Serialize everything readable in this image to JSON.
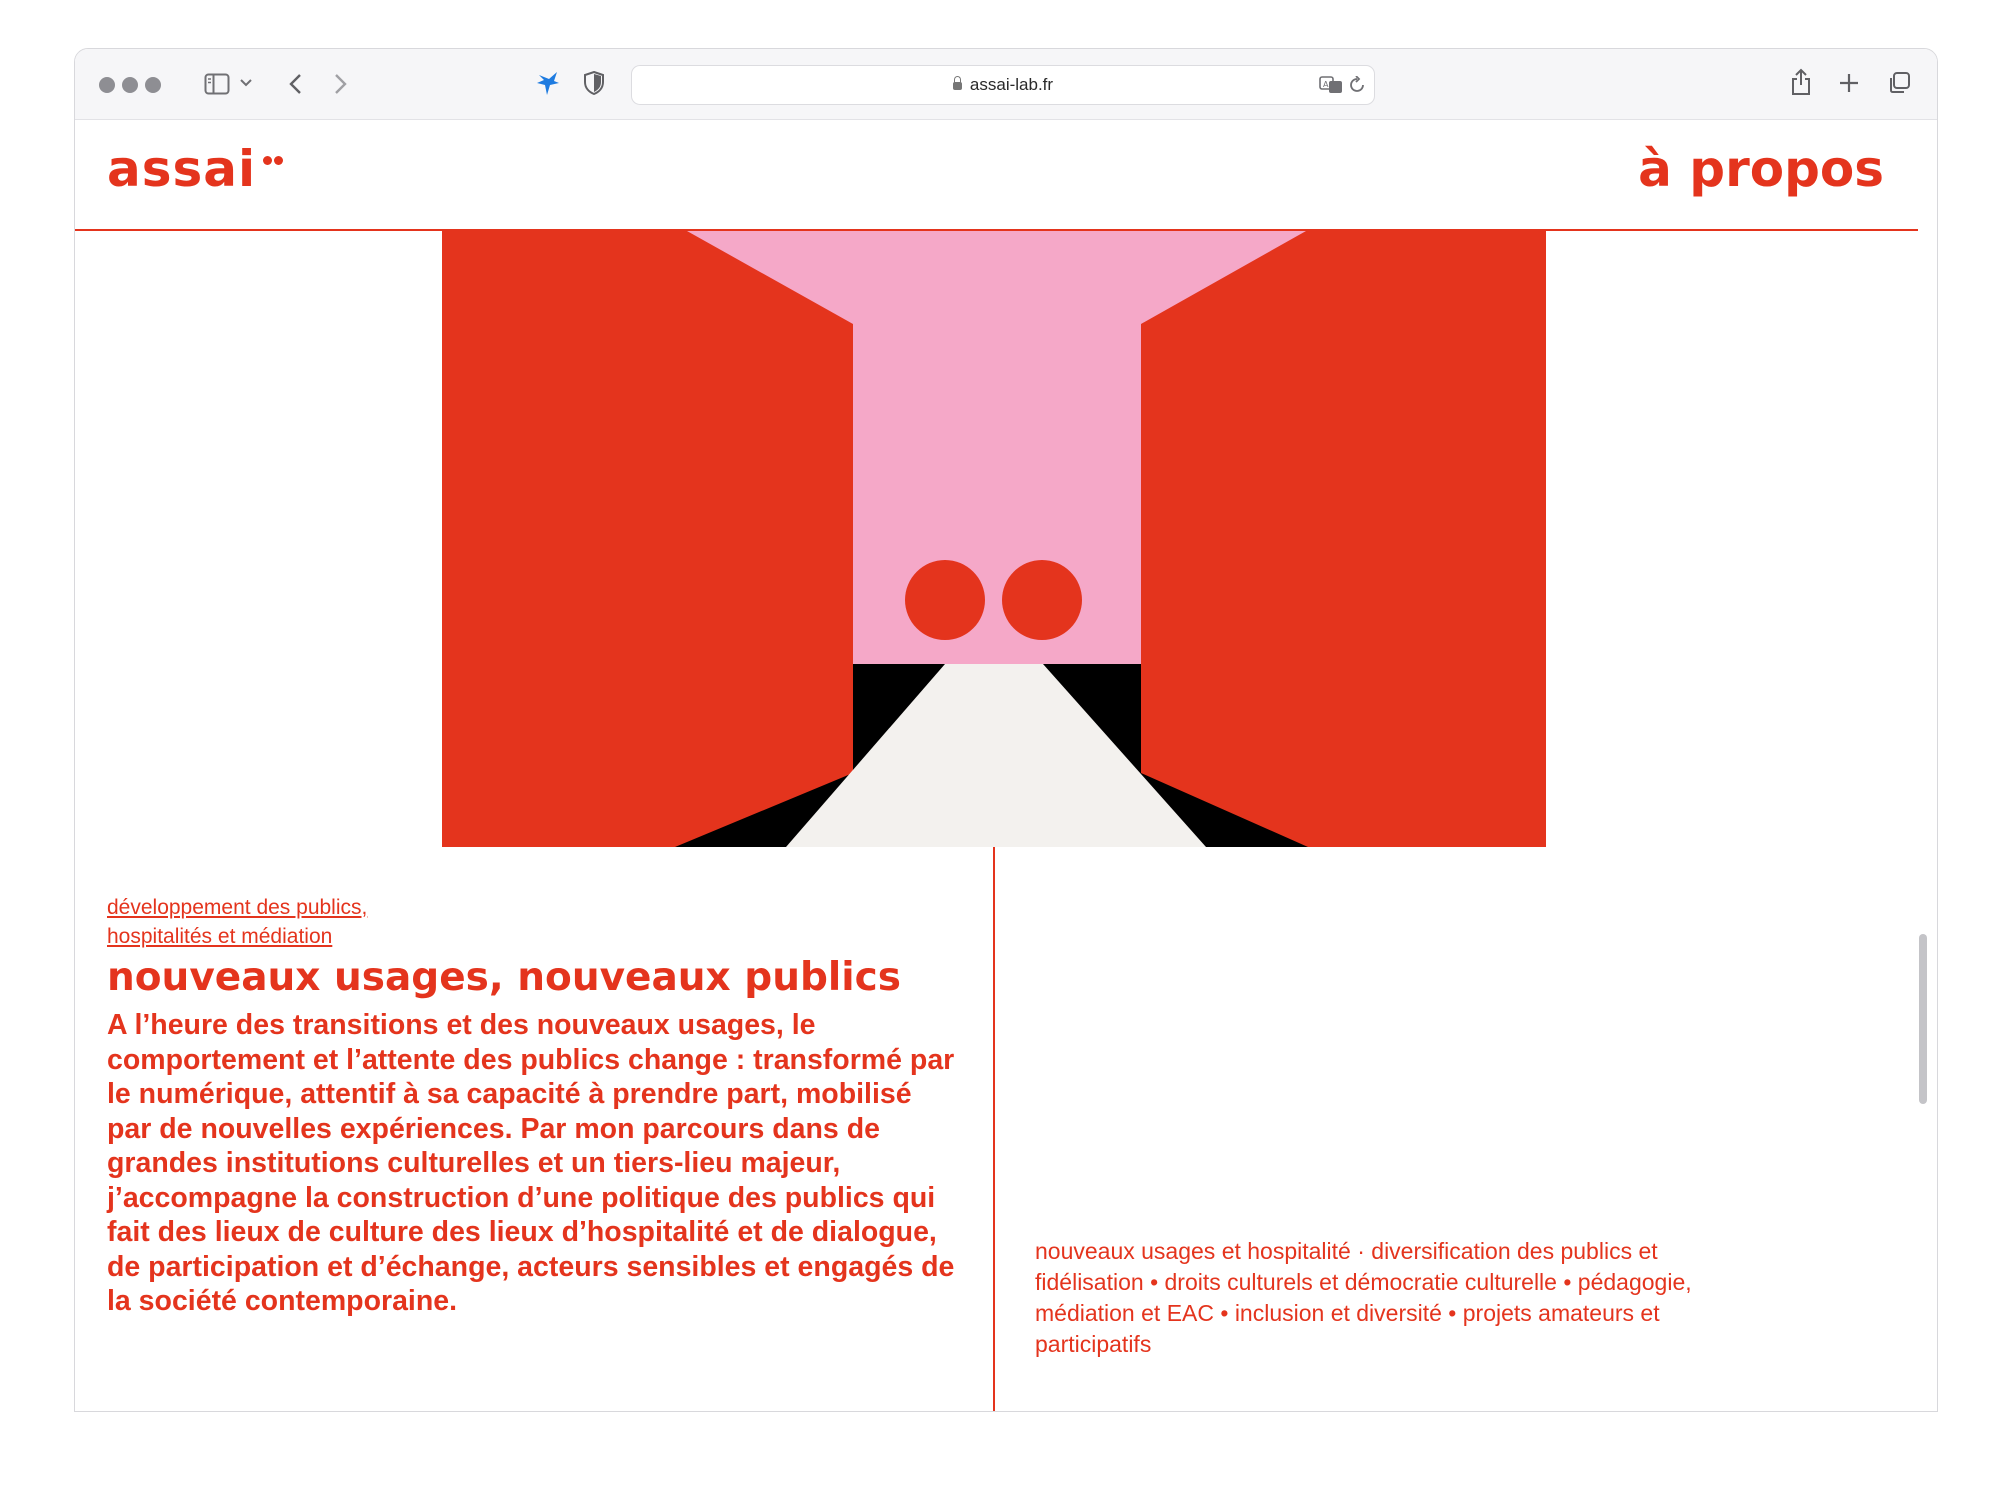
{
  "browser": {
    "url": "assai-lab.fr",
    "icons": {
      "sidebar": "sidebar-icon",
      "back": "chevron-left-icon",
      "forward": "chevron-right-icon",
      "extension": "bird-icon",
      "privacy": "shield-icon",
      "translate": "translate-icon",
      "reload": "reload-icon",
      "share": "share-icon",
      "new_tab": "plus-icon",
      "tabs": "tabs-overview-icon"
    }
  },
  "site": {
    "logo": "assai",
    "nav": "à propos",
    "breadcrumb_line1": "développement des publics,",
    "breadcrumb_line2": "hospitalités et médiation",
    "title": "nouveaux usages, nouveaux publics",
    "lead": "A l’heure des transitions et des nouveaux usages, le comportement et l’attente des publics change : transformé par le numérique, attentif à sa capacité à prendre part, mobilisé par de nouvelles expériences. Par mon parcours dans de grandes institutions culturelles et un tiers-lieu majeur, j’accompagne la construction d’une politique des publics qui fait des lieux de culture des lieux d’hospitalité et de dialogue, de participation et d’échange, acteurs sensibles et engagés de la société contemporaine.",
    "tags": "nouveaux usages et hospitalité ·  diversification des publics et fidélisation • droits culturels et démocratie culturelle • pédagogie, médiation et EAC • inclusion et diversité •  projets amateurs et participatifs"
  },
  "colors": {
    "brand_red": "#e4341d",
    "pink": "#f5a8c8",
    "black": "#000000",
    "cream": "#f3f1ee"
  }
}
